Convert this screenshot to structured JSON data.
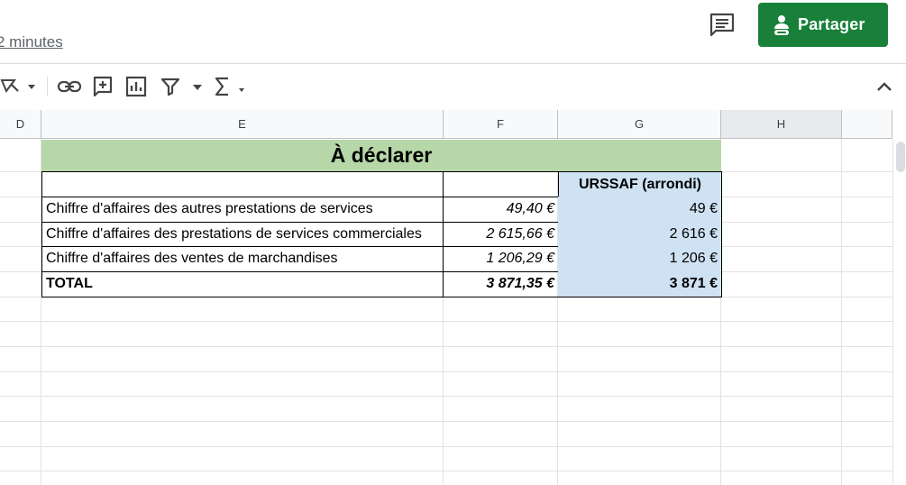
{
  "header": {
    "last_edit": "2 minutes",
    "share_label": "Partager"
  },
  "toolbar": {
    "icons": [
      "paint-format-icon",
      "insert-link-icon",
      "insert-comment-icon",
      "insert-chart-icon",
      "filter-icon",
      "functions-icon",
      "collapse-toolbar-icon"
    ]
  },
  "grid": {
    "columns": [
      "D",
      "E",
      "F",
      "G",
      "H"
    ],
    "title": "À déclarer",
    "g_header": "URSSAF (arrondi)",
    "rows": [
      {
        "label": "Chiffre d'affaires des autres prestations de services",
        "amount": "49,40 €",
        "rounded": "49 €"
      },
      {
        "label": "Chiffre d'affaires des prestations de services commerciales",
        "amount": "2 615,66 €",
        "rounded": "2 616 €"
      },
      {
        "label": "Chiffre d'affaires des ventes de marchandises",
        "amount": "1 206,29 €",
        "rounded": "1 206 €"
      }
    ],
    "total": {
      "label": "TOTAL",
      "amount": "3 871,35 €",
      "rounded": "3 871 €"
    }
  },
  "colors": {
    "share_button": "#188038",
    "title_fill": "#b6d7a8",
    "urssaf_fill": "#cfe2f3"
  }
}
